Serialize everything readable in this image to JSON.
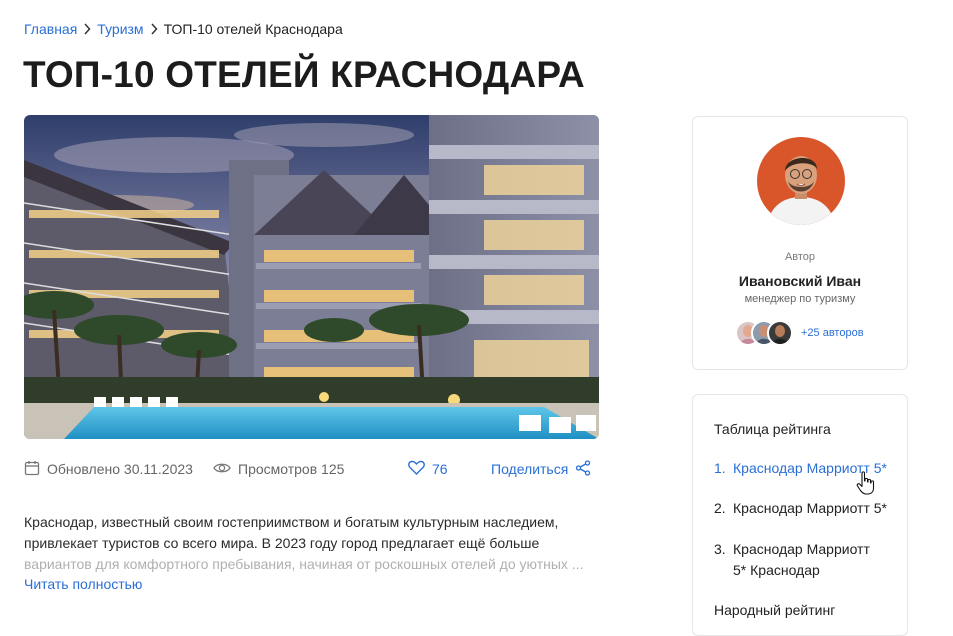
{
  "breadcrumb": {
    "home": "Главная",
    "section": "Туризм",
    "current": "ТОП-10 отелей Краснодара"
  },
  "page_title": "ТОП-10 ОТЕЛЕЙ КРАСНОДАРА",
  "meta": {
    "updated": "Обновлено 30.11.2023",
    "views": "Просмотров 125",
    "likes": "76",
    "share": "Поделиться"
  },
  "article": {
    "text_visible": "Краснодар, известный своим гостеприимством и богатым культурным наследием, привлекает туристов со всего мира. В 2023 году город предлагает ещё больше",
    "text_faded": "вариантов для комфортного пребывания, начиная от роскошных отелей до уютных ...",
    "read_more": "Читать полностью"
  },
  "author": {
    "caption": "Автор",
    "name": "Ивановский Иван",
    "role": "менеджер по туризму",
    "more_authors": "+25 авторов"
  },
  "rating": {
    "title": "Таблица рейтинга",
    "items": [
      {
        "num": "1.",
        "label": "Краснодар Марриотт 5*"
      },
      {
        "num": "2.",
        "label": "Краснодар Марриотт 5*"
      },
      {
        "num": "3.",
        "label": "Краснодар Марриотт 5* Краснодар"
      }
    ],
    "footer": "Народный рейтинг"
  },
  "colors": {
    "accent": "#2a6fd6",
    "text": "#1f1f1f",
    "muted": "#666666",
    "border": "#e6e6e6"
  },
  "icons": [
    "chevron-right-icon",
    "calendar-icon",
    "eye-icon",
    "heart-icon",
    "share-icon",
    "hand-pointer-icon"
  ]
}
